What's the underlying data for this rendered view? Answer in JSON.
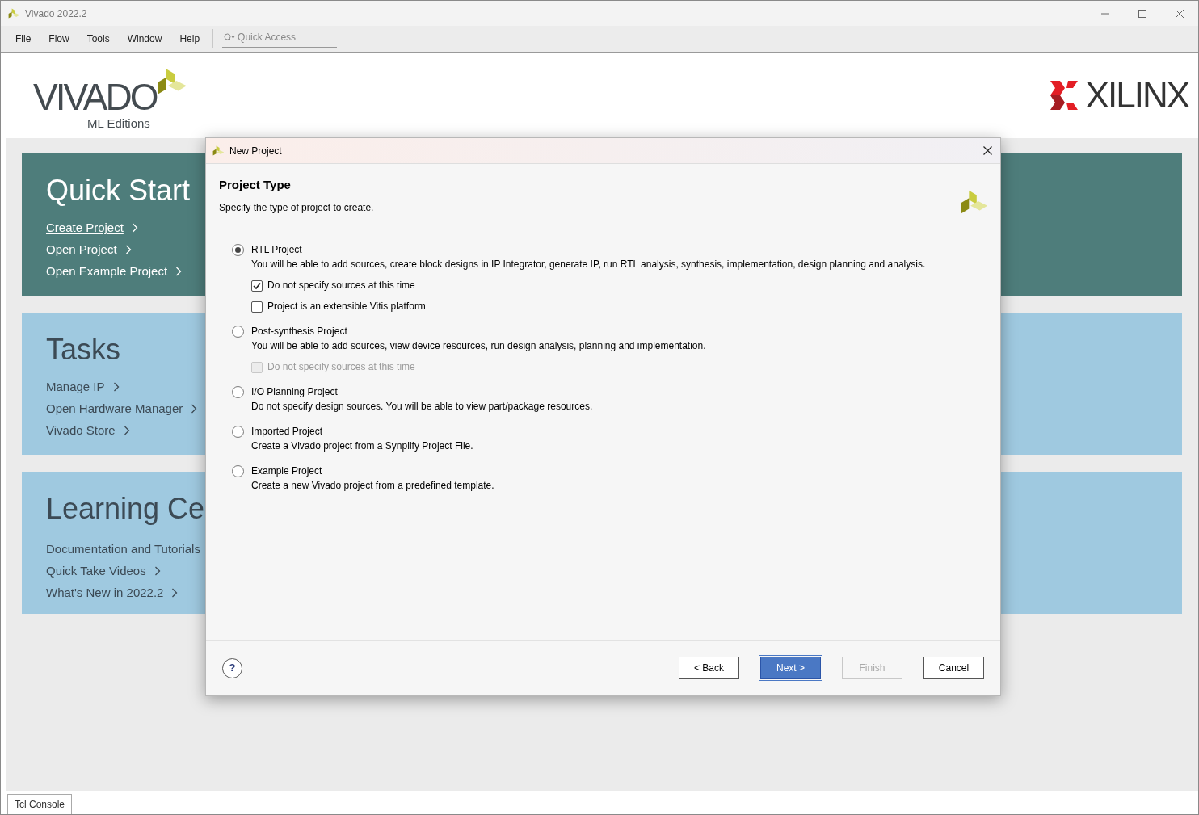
{
  "window": {
    "title": "Vivado 2022.2"
  },
  "menu": [
    "File",
    "Flow",
    "Tools",
    "Window",
    "Help"
  ],
  "quick_access": {
    "placeholder": "Quick Access"
  },
  "logo": {
    "product": "VIVADO",
    "edition": "ML Editions",
    "vendor": "XILINX"
  },
  "panels": [
    {
      "title": "Quick Start",
      "kind": "dark",
      "links": [
        {
          "label": "Create Project",
          "underlined": true,
          "kind": "chevron"
        },
        {
          "label": "Open Project",
          "underlined": false,
          "kind": "chevron"
        },
        {
          "label": "Open Example Project",
          "underlined": false,
          "kind": "chevron"
        }
      ]
    },
    {
      "title": "Tasks",
      "kind": "light",
      "links": [
        {
          "label": "Manage IP",
          "underlined": false,
          "kind": "chevron"
        },
        {
          "label": "Open Hardware Manager",
          "underlined": false,
          "kind": "chevron"
        },
        {
          "label": "Vivado Store",
          "underlined": false,
          "kind": "chevron"
        }
      ]
    },
    {
      "title": "Learning Ce",
      "kind": "light",
      "links": [
        {
          "label": "Documentation and Tutorials",
          "underlined": false,
          "kind": "plain"
        },
        {
          "label": "Quick Take Videos",
          "underlined": false,
          "kind": "chevron"
        },
        {
          "label": "What's New in 2022.2",
          "underlined": false,
          "kind": "chevron"
        }
      ]
    }
  ],
  "dialog": {
    "title": "New Project",
    "heading": "Project Type",
    "subtitle": "Specify the type of project to create.",
    "options": [
      {
        "label": "RTL Project",
        "description": "You will be able to add sources, create block designs in IP Integrator, generate IP, run RTL analysis, synthesis, implementation, design planning and analysis.",
        "selected": true,
        "suboptions": [
          {
            "label": "Do not specify sources at this time",
            "checked": true,
            "disabled": false
          },
          {
            "label": "Project is an extensible Vitis platform",
            "checked": false,
            "disabled": false
          }
        ]
      },
      {
        "label": "Post-synthesis Project",
        "description": "You will be able to add sources, view device resources, run design analysis, planning and implementation.",
        "selected": false,
        "suboptions": [
          {
            "label": "Do not specify sources at this time",
            "checked": false,
            "disabled": true
          }
        ]
      },
      {
        "label": "I/O Planning Project",
        "description": "Do not specify design sources. You will be able to view part/package resources.",
        "selected": false
      },
      {
        "label": "Imported Project",
        "description": "Create a Vivado project from a Synplify Project File.",
        "selected": false
      },
      {
        "label": "Example Project",
        "description": "Create a new Vivado project from a predefined template.",
        "selected": false
      }
    ],
    "help": "?",
    "buttons": [
      {
        "label": "< Back",
        "kind": "normal",
        "disabled": false
      },
      {
        "label": "Next >",
        "kind": "primary",
        "disabled": false
      },
      {
        "label": "Finish",
        "kind": "normal",
        "disabled": true
      },
      {
        "label": "Cancel",
        "kind": "normal",
        "disabled": false
      }
    ]
  },
  "console_tab": {
    "label": "Tcl Console"
  }
}
